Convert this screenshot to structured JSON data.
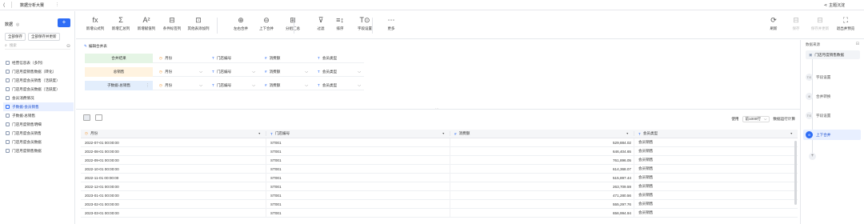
{
  "app": {
    "title": "数据分析大赛",
    "menu_more": "⋮",
    "share_label": "主题沉淀"
  },
  "left": {
    "header": "数据",
    "add_label": "+",
    "btn_save_all": "全部保存",
    "btn_save_update": "全部保存并更新",
    "search_placeholder": "搜索",
    "items": [
      {
        "label": "经营信息表（多列）",
        "active": false
      },
      {
        "label": "门店月度销售数据（转化）",
        "active": false
      },
      {
        "label": "门店月度会员销售（活跃度）",
        "active": false
      },
      {
        "label": "门店月度会员数据（活跃度）",
        "active": false
      },
      {
        "label": "会员消费情况",
        "active": false
      },
      {
        "label": "子数据-会员销售",
        "active": true
      },
      {
        "label": "子数据-总销售",
        "active": false
      },
      {
        "label": "门店月度销售明细",
        "active": false
      },
      {
        "label": "门店月度会员销售",
        "active": false
      },
      {
        "label": "门店月度会员数据",
        "active": false
      },
      {
        "label": "门店月度销售数据",
        "active": false
      }
    ]
  },
  "toolbar": {
    "tools": [
      {
        "icon": "fx",
        "label": "新增公式列"
      },
      {
        "icon": "Σ",
        "label": "新增汇总列"
      },
      {
        "icon": "A²",
        "label": "新增赋值列"
      },
      {
        "icon": "⊟",
        "label": "条件标签列"
      },
      {
        "icon": "⊡",
        "label": "其他表添加列"
      },
      {
        "icon": "⊕",
        "label": "左右合并"
      },
      {
        "icon": "⊖",
        "label": "上下合并"
      },
      {
        "icon": "⊞",
        "label": "分组汇总"
      },
      {
        "icon": "⊽",
        "label": "过滤"
      },
      {
        "icon": "≡↕",
        "label": "排序"
      },
      {
        "icon": "T⊙",
        "label": "字段设置"
      },
      {
        "icon": "⋯",
        "label": "更多"
      }
    ],
    "right_tools": [
      {
        "icon": "⟳",
        "label": "刷新"
      },
      {
        "icon": "⊟",
        "label": "保存"
      },
      {
        "icon": "⊟",
        "label": "保存并更新"
      },
      {
        "icon": "⛶",
        "label": "退出并预览"
      }
    ]
  },
  "editor": {
    "caption": "编辑合并表",
    "rows": [
      {
        "name": "合并结果",
        "fields": [
          "月份",
          "门店编号",
          "消费额",
          "会员类型"
        ]
      },
      {
        "name": "总销售",
        "fields": [
          "月份",
          "门店编号",
          "消费额",
          "会员类型"
        ]
      },
      {
        "name": "子数据-总销售",
        "fields": [
          "月份",
          "门店编号",
          "消费额",
          "会员类型"
        ]
      }
    ]
  },
  "viewbar": {
    "use_label": "使用",
    "rows_select": "前1000行",
    "exec_label": "数据运行计算"
  },
  "grid": {
    "headers": [
      "月份",
      "门店编号",
      "消费额",
      "会员类型"
    ],
    "rows": [
      [
        "2022-07-01 00:00:00",
        "ST001",
        "529,884.02",
        "会员销售"
      ],
      [
        "2022-08-01 00:00:00",
        "ST001",
        "646,404.65",
        "会员销售"
      ],
      [
        "2022-09-01 00:00:00",
        "ST001",
        "761,896.05",
        "会员销售"
      ],
      [
        "2022-10-01 00:00:00",
        "ST001",
        "614,368.07",
        "会员销售"
      ],
      [
        "2022-11-01 00:00:00",
        "ST001",
        "515,897.44",
        "会员销售"
      ],
      [
        "2022-12-01 00:00:00",
        "ST001",
        "263,709.59",
        "会员销售"
      ],
      [
        "2023-01-01 00:00:00",
        "ST001",
        "471,280.56",
        "会员销售"
      ],
      [
        "2023-02-01 00:00:00",
        "ST001",
        "555,297.76",
        "会员销售"
      ],
      [
        "2023-03-01 00:00:00",
        "ST001",
        "656,994.94",
        "会员销售"
      ]
    ]
  },
  "right_panel": {
    "caption": "数据来源",
    "source": "门店月度销售数据",
    "steps": [
      {
        "label": "字段设置",
        "active": false
      },
      {
        "label": "合并转换",
        "active": false
      },
      {
        "label": "字段设置",
        "active": false
      },
      {
        "label": "上下合并",
        "active": true
      }
    ]
  }
}
